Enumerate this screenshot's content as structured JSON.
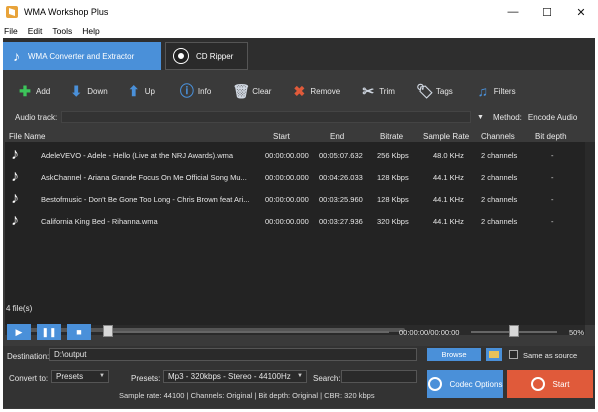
{
  "window": {
    "title": "WMA Workshop Plus",
    "min": "—",
    "max": "☐",
    "close": "✕"
  },
  "menu": [
    "File",
    "Edit",
    "Tools",
    "Help"
  ],
  "tabs": {
    "converter": "WMA Converter and Extractor",
    "ripper": "CD Ripper"
  },
  "toolbar": {
    "add": "Add",
    "down": "Down",
    "up": "Up",
    "info": "Info",
    "clear": "Clear",
    "remove": "Remove",
    "trim": "Trim",
    "tags": "Tags",
    "filters": "Filters"
  },
  "audio": {
    "track_label": "Audio track:",
    "method_label": "Method:",
    "method_value": "Encode Audio"
  },
  "columns": [
    "File Name",
    "Start",
    "End",
    "Bitrate",
    "Sample Rate",
    "Channels",
    "Bit depth"
  ],
  "files": [
    {
      "name": "AdeleVEVO - Adele - Hello (Live at the NRJ Awards).wma",
      "start": "00:00:00.000",
      "end": "00:05:07.632",
      "bitrate": "256 Kbps",
      "sample": "48.0 KHz",
      "channels": "2 channels",
      "depth": "-"
    },
    {
      "name": "AskChannel - Ariana Grande Focus On Me Official Song Mu...",
      "start": "00:00:00.000",
      "end": "00:04:26.033",
      "bitrate": "128 Kbps",
      "sample": "44.1 KHz",
      "channels": "2 channels",
      "depth": "-"
    },
    {
      "name": "Bestofmusic - Don't Be Gone Too Long - Chris Brown feat Ari...",
      "start": "00:00:00.000",
      "end": "00:03:25.960",
      "bitrate": "128 Kbps",
      "sample": "44.1 KHz",
      "channels": "2 channels",
      "depth": "-"
    },
    {
      "name": "California King Bed - Rihanna.wma",
      "start": "00:00:00.000",
      "end": "00:03:27.936",
      "bitrate": "320 Kbps",
      "sample": "44.1 KHz",
      "channels": "2 channels",
      "depth": "-"
    }
  ],
  "file_count": "4 file(s)",
  "player": {
    "time": "00:00:00/00:00:00",
    "volume": "50%"
  },
  "destination": {
    "label": "Destination:",
    "value": "D:\\output",
    "browse": "Browse",
    "same_as_source": "Same as source"
  },
  "convert": {
    "label": "Convert to:",
    "value": "Presets",
    "presets_label": "Presets:",
    "presets_value": "Mp3 - 320kbps - Stereo - 44100Hz",
    "search_label": "Search:"
  },
  "buttons": {
    "codec": "Codec Options",
    "start": "Start"
  },
  "status": "Sample rate: 44100 | Channels: Original | Bit depth: Original | CBR: 320 kbps",
  "colors": {
    "accent": "#4a90d9",
    "start": "#e05a3a",
    "panel": "#3a3a3a"
  }
}
